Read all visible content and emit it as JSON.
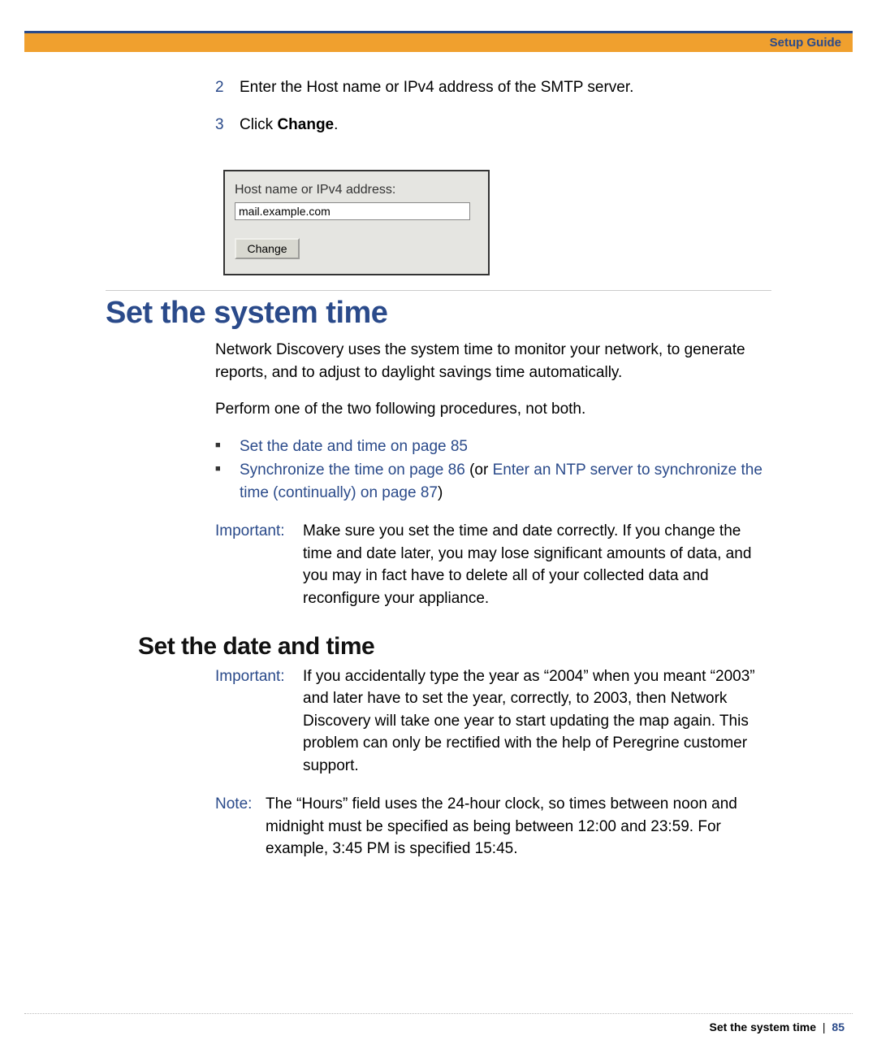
{
  "header": {
    "title": "Setup Guide"
  },
  "steps": {
    "s2": {
      "num": "2",
      "text": "Enter the Host name or IPv4 address of the SMTP server."
    },
    "s3": {
      "num": "3",
      "prefix": "Click ",
      "bold": "Change",
      "suffix": "."
    }
  },
  "smtp": {
    "label": "Host name or IPv4 address:",
    "value": "mail.example.com",
    "button": "Change"
  },
  "section_title": "Set the system time",
  "para1": "Network Discovery uses the system time to monitor your network, to generate reports, and to adjust to daylight savings time automatically.",
  "para2": "Perform one of the two following procedures, not both.",
  "bullets": {
    "b1": "Set the date and time on page 85",
    "b2_link1": "Synchronize the time on page 86",
    "b2_mid": " (or ",
    "b2_link2": "Enter an NTP server to synchronize the time (continually) on page 87",
    "b2_end": ")"
  },
  "important1": {
    "label": "Important:",
    "text": "Make sure you set the time and date correctly. If you change the time and date later, you may lose significant amounts of data, and you may in fact have to delete all of your collected data and reconfigure your appliance."
  },
  "subsection_title": "Set the date and time",
  "important2": {
    "label": "Important:",
    "text": "If you accidentally type the year as “2004” when you meant “2003” and later have to set the year, correctly, to 2003, then Network Discovery will take one year to start updating the map again. This problem can only be rectified with the help of Peregrine customer support."
  },
  "note1": {
    "label": "Note:",
    "text": "The “Hours” field uses the 24-hour clock, so times between noon and midnight must be specified as being between 12:00 and 23:59. For example, 3:45 PM is specified 15:45."
  },
  "footer": {
    "section": "Set the system time",
    "page": "85"
  }
}
